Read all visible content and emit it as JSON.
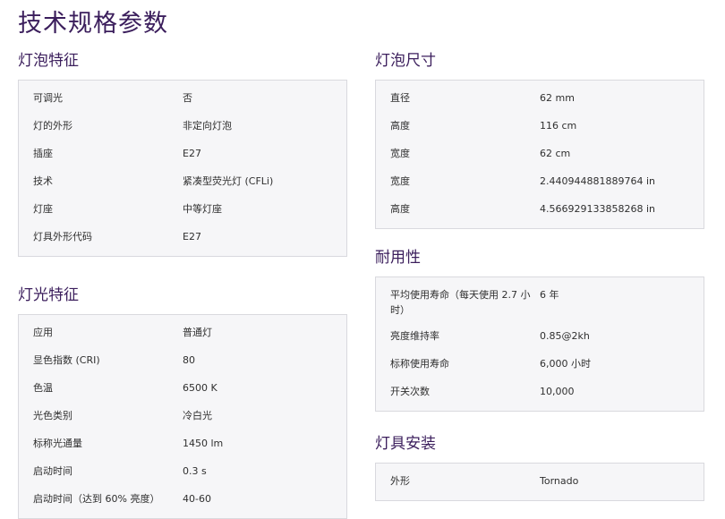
{
  "page": {
    "title": "技术规格参数"
  },
  "left_sections": [
    {
      "title": "灯泡特征",
      "rows": [
        {
          "label": "可调光",
          "value": "否"
        },
        {
          "label": "灯的外形",
          "value": "非定向灯泡"
        },
        {
          "label": "插座",
          "value": "E27"
        },
        {
          "label": "技术",
          "value": "紧凑型荧光灯 (CFLi)"
        },
        {
          "label": "灯座",
          "value": "中等灯座"
        },
        {
          "label": "灯具外形代码",
          "value": "E27"
        }
      ]
    },
    {
      "title": "灯光特征",
      "rows": [
        {
          "label": "应用",
          "value": "普通灯"
        },
        {
          "label": "显色指数 (CRI)",
          "value": "80"
        },
        {
          "label": "色温",
          "value": "6500  K"
        },
        {
          "label": "光色类别",
          "value": "冷白光"
        },
        {
          "label": "标称光通量",
          "value": "1450  lm"
        },
        {
          "label": "启动时间",
          "value": "0.3 s"
        },
        {
          "label": "启动时间（达到 60% 亮度）",
          "value": "40-60"
        }
      ]
    }
  ],
  "right_sections": [
    {
      "title": "灯泡尺寸",
      "rows": [
        {
          "label": "直径",
          "value": "62  mm"
        },
        {
          "label": "高度",
          "value": "116  cm"
        },
        {
          "label": "宽度",
          "value": "62  cm"
        },
        {
          "label": "宽度",
          "value": "2.440944881889764  in"
        },
        {
          "label": "高度",
          "value": "4.566929133858268  in"
        }
      ]
    },
    {
      "title": "耐用性",
      "rows": [
        {
          "label": "平均使用寿命（每天使用 2.7 小时）",
          "value": "6  年"
        },
        {
          "label": "亮度维持率",
          "value": "0.85@2kh"
        },
        {
          "label": "标称使用寿命",
          "value": "6,000  小时"
        },
        {
          "label": "开关次数",
          "value": "10,000"
        }
      ]
    },
    {
      "title": "灯具安装",
      "rows": [
        {
          "label": "外形",
          "value": "Tornado"
        }
      ]
    }
  ]
}
